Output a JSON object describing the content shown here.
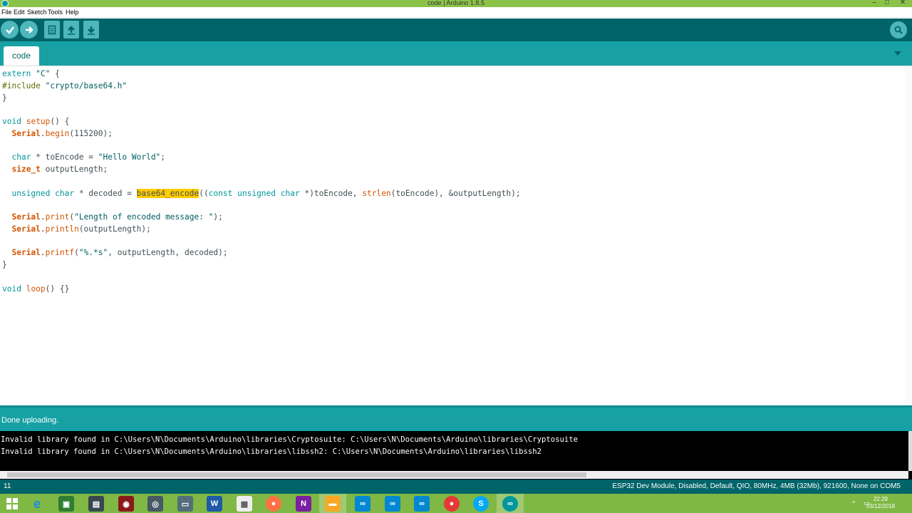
{
  "window": {
    "title": "code | Arduino 1.8.5",
    "controls": [
      "–",
      "□",
      "✕"
    ]
  },
  "menu": [
    "File",
    "Edit",
    "Sketch",
    "Tools",
    "Help"
  ],
  "toolbar": {
    "verify_icon": "check-icon",
    "upload_icon": "arrow-right-icon",
    "new_icon": "new-file-icon",
    "open_icon": "open-up-arrow-icon",
    "save_icon": "save-down-arrow-icon",
    "serial_monitor_icon": "magnifier-icon"
  },
  "tabs": [
    {
      "label": "code",
      "active": true
    }
  ],
  "code_lines": [
    "extern \"C\" {",
    "#include \"crypto/base64.h\"",
    "}",
    "",
    "void setup() {",
    "  Serial.begin(115200);",
    "",
    "  char * toEncode = \"Hello World\";",
    "  size_t outputLength;",
    "",
    "  unsigned char * decoded = base64_encode((const unsigned char *)toEncode, strlen(toEncode), &outputLength);",
    "",
    "  Serial.print(\"Length of encoded message: \");",
    "  Serial.println(outputLength);",
    "",
    "  Serial.printf(\"%.*s\", outputLength, decoded);",
    "}",
    "",
    "void loop() {}"
  ],
  "highlighted_selection": "base64_encode",
  "status": "Done uploading.",
  "console_lines": [
    "Invalid library found in C:\\Users\\N\\Documents\\Arduino\\libraries\\Cryptosuite: C:\\Users\\N\\Documents\\Arduino\\libraries\\Cryptosuite",
    "Invalid library found in C:\\Users\\N\\Documents\\Arduino\\libraries\\libssh2: C:\\Users\\N\\Documents\\Arduino\\libraries\\libssh2"
  ],
  "footer": {
    "line_number": "11",
    "board": "ESP32 Dev Module, Disabled, Default, QIO, 80MHz, 4MB (32Mb), 921600, None on COM5"
  },
  "taskbar": {
    "time": "22:29",
    "date": "03/12/2018",
    "tray_arrow": "^"
  },
  "colors": {
    "titlebar": "#8bc34a",
    "toolbar": "#006468",
    "tabbar": "#17a1a5",
    "console": "#000000",
    "highlight": "#ffcc00"
  }
}
